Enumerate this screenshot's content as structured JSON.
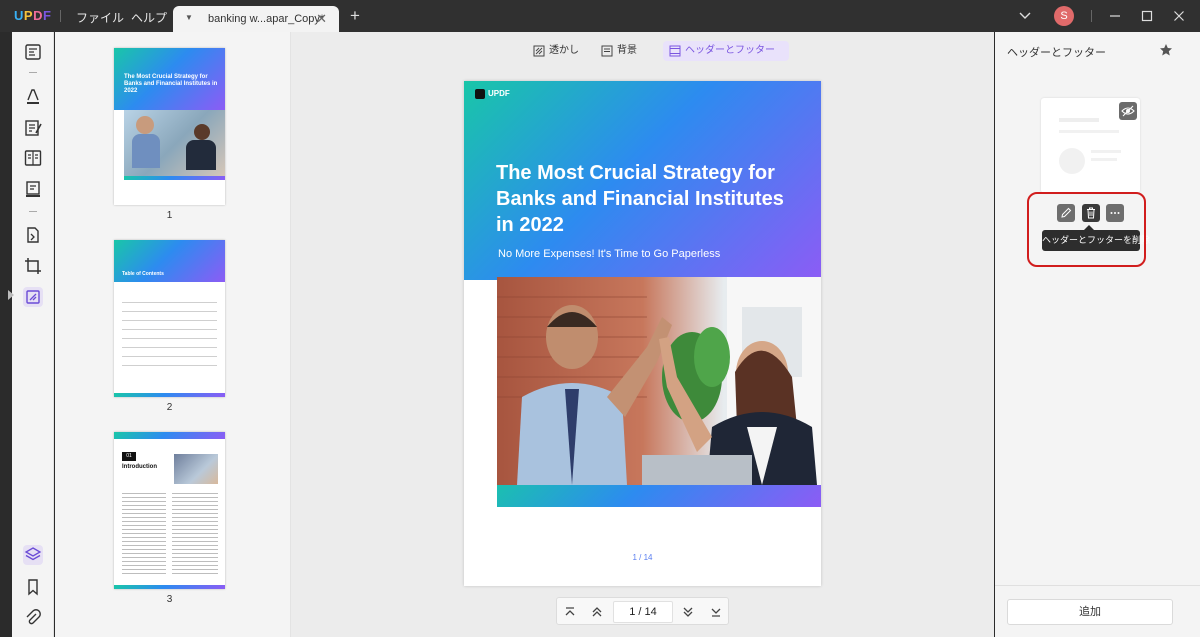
{
  "titlebar": {
    "logo": "UPDF",
    "menu": [
      "ファイル",
      "ヘルプ"
    ],
    "tab_title": "banking w...apar_Copy*",
    "avatar_initial": "S",
    "accent_colors": {
      "u": "#39b1f5",
      "p": "#f5c33b",
      "d": "#f06d9a",
      "f": "#7a55e0"
    }
  },
  "left_toolbar": {
    "tools": [
      "reader-icon",
      "comment-icon",
      "edit-text-icon",
      "organize-pages-icon",
      "fill-sign-icon",
      "convert-icon",
      "crop-icon",
      "page-tools-icon"
    ],
    "bottom": [
      "layers-icon",
      "bookmark-icon",
      "attachment-icon"
    ]
  },
  "thumbnails": [
    {
      "number": "1",
      "title": "The Most Crucial Strategy for Banks and Financial Institutes in 2022"
    },
    {
      "number": "2",
      "title": "Table of Contents"
    },
    {
      "number": "3",
      "chapter": "01",
      "title": "Introduction"
    }
  ],
  "toolbar": {
    "watermark": "透かし",
    "background": "背景",
    "header_footer": "ヘッダーとフッター"
  },
  "page": {
    "brand": "UPDF",
    "title": "The Most Crucial Strategy for Banks and Financial Institutes in 2022",
    "subtitle": "No More Expenses! It's Time to Go Paperless",
    "page_indicator": "1 / 14"
  },
  "navigation": {
    "current_page": "1",
    "total_pages": "14"
  },
  "right_panel": {
    "title": "ヘッダーとフッター",
    "tooltip": "ヘッダーとフッターを削除",
    "add_label": "追加",
    "highlight_color": "#d11d1d"
  }
}
